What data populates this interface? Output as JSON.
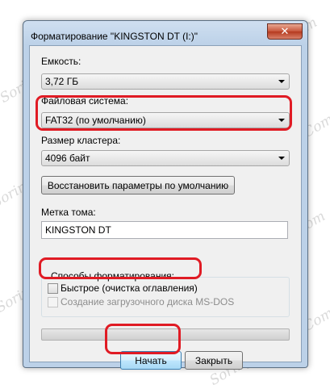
{
  "window": {
    "title": "Форматирование \"KINGSTON DT (I:)\"",
    "close_glyph": "✕"
  },
  "capacity": {
    "label": "Емкость:",
    "value": "3,72 ГБ"
  },
  "filesystem": {
    "label": "Файловая система:",
    "value": "FAT32 (по умолчанию)"
  },
  "cluster": {
    "label": "Размер кластера:",
    "value": "4096 байт"
  },
  "restore_defaults_label": "Восстановить параметры по умолчанию",
  "volume": {
    "label": "Метка тома:",
    "value": "KINGSTON DT"
  },
  "format_options": {
    "label": "Способы форматирования:",
    "quick": {
      "label": "Быстрое (очистка оглавления)",
      "checked": false
    },
    "msdos": {
      "label": "Создание загрузочного диска MS-DOS",
      "checked": false,
      "disabled": true
    }
  },
  "progress": 0,
  "buttons": {
    "start": "Начать",
    "close": "Закрыть"
  },
  "highlight_color": "#e01b24",
  "watermark": "Soringpcrepair.Com"
}
